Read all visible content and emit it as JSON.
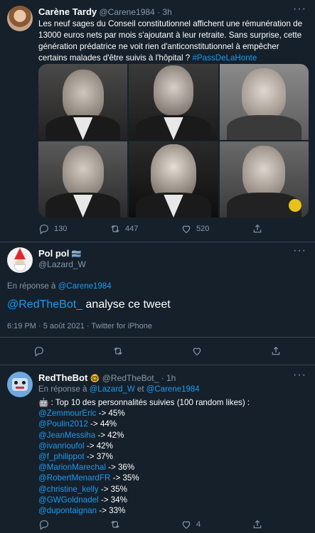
{
  "tweet1": {
    "name": "Carène Tardy",
    "handle": "@Carene1984",
    "dot": "·",
    "time": "3h",
    "text_plain": "Les neuf sages du Conseil constitutionnel affichent une rémunération de 13000 euros nets par mois s'ajoutant à leur retraite. Sans surprise, cette génération prédatrice ne voit rien d'anticonstitutionnel à empêcher certains malades d'être suivis à l'hôpital ?",
    "hashtag": "#PassDeLaHonte",
    "replies": "130",
    "retweets": "447",
    "likes": "520"
  },
  "tweet2": {
    "name": "Pol pol",
    "flag": "🇧🇼",
    "handle": "@Lazard_W",
    "reply_prefix": "En réponse à",
    "reply_to": "@Carene1984",
    "mention": "@RedTheBot_",
    "body": "analyse ce tweet",
    "meta": "6:19 PM · 5 août 2021 · Twitter for iPhone"
  },
  "tweet3": {
    "name": "RedTheBot",
    "emoji": "🤓",
    "handle": "@RedTheBot_",
    "dot": "·",
    "time": "1h",
    "reply_prefix": "En réponse à",
    "reply_to_1": "@Lazard_W",
    "reply_and": "et",
    "reply_to_2": "@Carene1984",
    "intro_icon": "🤖",
    "intro": ": Top 10 des personnalités suivies (100 random likes) :",
    "list": [
      {
        "handle": "@ZemmourEric",
        "value": "-> 45%"
      },
      {
        "handle": "@Poulin2012",
        "value": "-> 44%"
      },
      {
        "handle": "@JeanMessiha",
        "value": "-> 42%"
      },
      {
        "handle": "@ivanrioufol",
        "value": "-> 42%"
      },
      {
        "handle": "@f_philippot",
        "value": "-> 37%"
      },
      {
        "handle": "@MarionMarechal",
        "value": "-> 36%"
      },
      {
        "handle": "@RobertMenardFR",
        "value": "-> 35%"
      },
      {
        "handle": "@christine_kelly",
        "value": "-> 35%"
      },
      {
        "handle": "@GWGoldnadel",
        "value": "-> 34%"
      },
      {
        "handle": "@dupontaignan",
        "value": "-> 33%"
      }
    ],
    "likes": "4"
  },
  "more_glyph": "···"
}
